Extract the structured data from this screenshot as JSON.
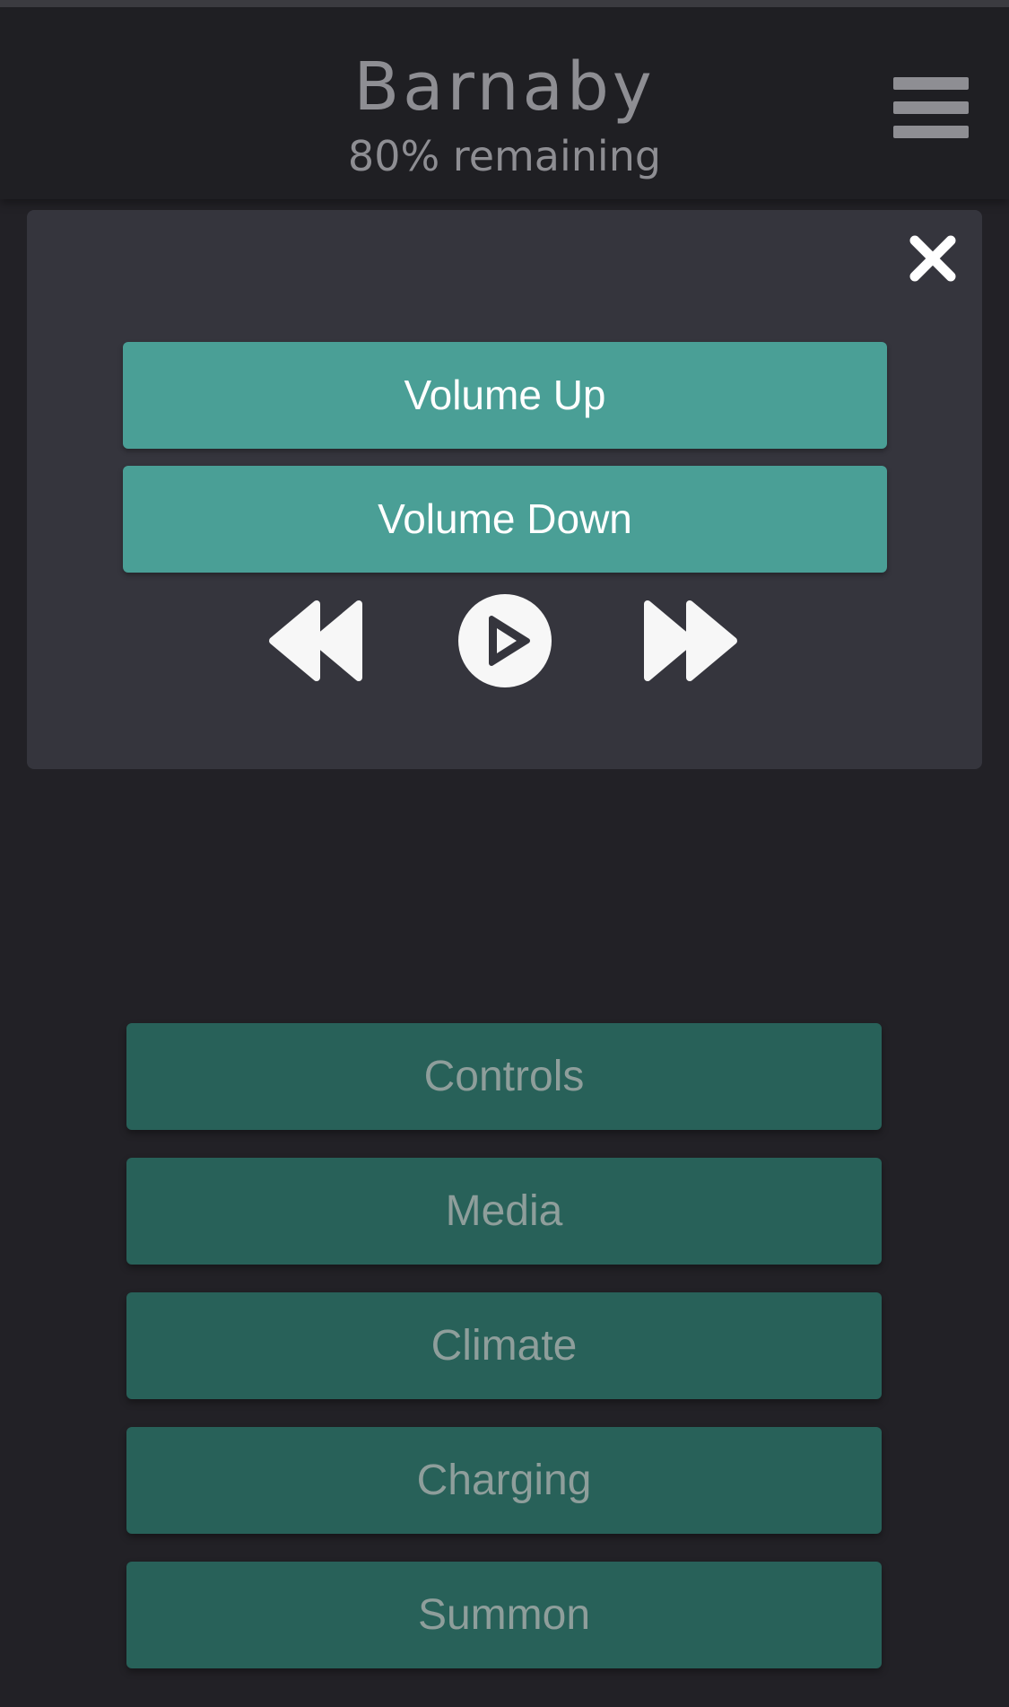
{
  "header": {
    "car_name": "Barnaby",
    "battery_status": "80% remaining",
    "menu_icon": "hamburger-menu-icon"
  },
  "media_panel": {
    "close_icon": "close-icon",
    "volume_up_label": "Volume Up",
    "volume_down_label": "Volume Down",
    "transport_icons": [
      "rewind-icon",
      "play-icon",
      "fast-forward-icon"
    ]
  },
  "nav": {
    "items": [
      {
        "label": "Controls"
      },
      {
        "label": "Media"
      },
      {
        "label": "Climate"
      },
      {
        "label": "Charging"
      },
      {
        "label": "Summon"
      }
    ]
  },
  "colors": {
    "background": "#222126",
    "header": "#1f1f23",
    "panel": "#35353d",
    "accent_button": "#4a9f96",
    "nav_button": "#286159",
    "muted_text": "#8e8e93"
  }
}
